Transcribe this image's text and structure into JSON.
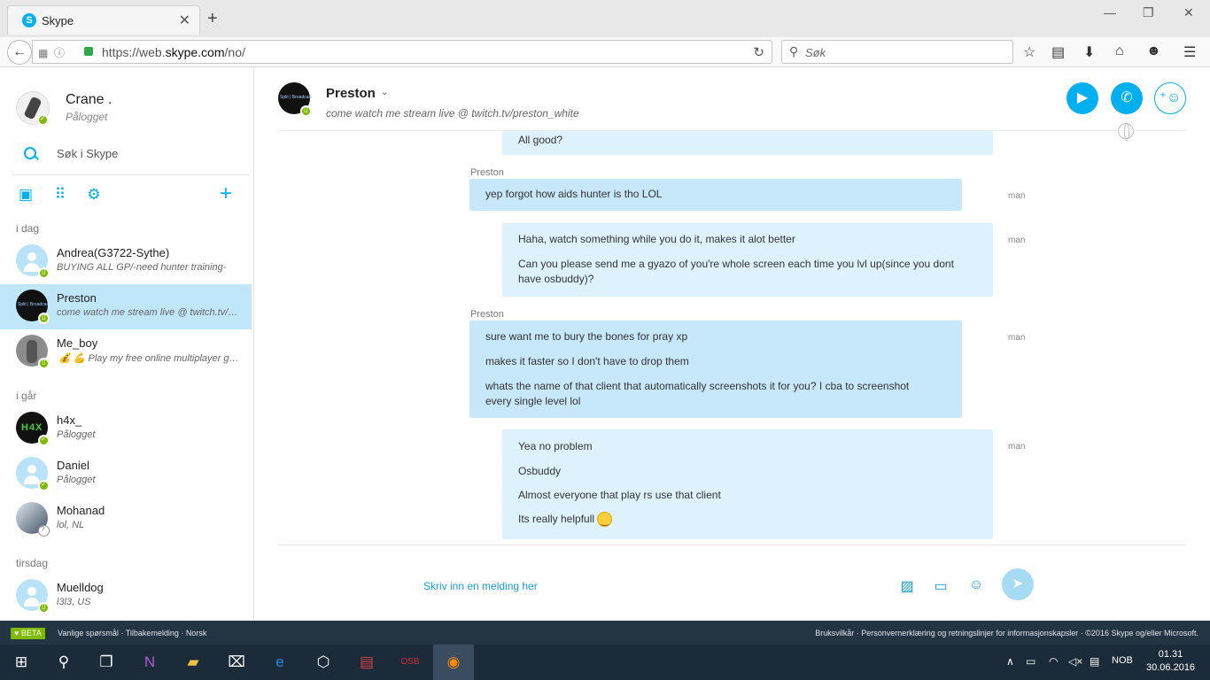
{
  "browser": {
    "tab_title": "Skype",
    "url_prefix": "https://web.",
    "url_host": "skype.com",
    "url_path": "/no/",
    "search_placeholder": "Søk"
  },
  "me": {
    "name": "Crane .",
    "status": "Pålogget"
  },
  "sidebar": {
    "search_label": "Søk i Skype",
    "groups": {
      "today": "i dag",
      "yesterday": "i går",
      "tuesday": "tirsdag"
    },
    "contacts": [
      {
        "name": "Andrea(G3722-Sythe)",
        "mood": "BUYING ALL GP/-need hunter training-"
      },
      {
        "name": "Preston",
        "mood": "come watch me stream live @ twitch.tv/preston_white"
      },
      {
        "name": "Me_boy",
        "mood": "Play my free online multiplayer game"
      },
      {
        "name": "h4x_",
        "mood": "Pålogget"
      },
      {
        "name": "Daniel",
        "mood": "Pålogget"
      },
      {
        "name": "Mohanad",
        "mood": "lol, NL"
      },
      {
        "name": "Muelldog",
        "mood": "l3l3, US"
      }
    ]
  },
  "conversation": {
    "name": "Preston",
    "mood": "come watch me stream live @ twitch.tv/preston_white",
    "messages": [
      {
        "lines": [
          "All good?"
        ]
      },
      {
        "sender": "Preston",
        "time": "man",
        "lines": [
          "yep forgot how aids hunter is tho LOL"
        ]
      },
      {
        "time": "man",
        "lines": [
          "Haha, watch something while you do it, makes it alot better",
          "Can you please send me a gyazo of you're whole screen each time you lvl up(since you dont have osbuddy)?"
        ]
      },
      {
        "sender": "Preston",
        "time": "man",
        "lines": [
          "sure want me to bury the bones for pray xp",
          "makes it faster so I don't have to drop them",
          "whats the name of that client that automatically screenshots it for you? I cba to screenshot every single level lol"
        ]
      },
      {
        "time": "man",
        "lines": [
          "Yea no problem",
          "Osbuddy",
          "Almost everyone that play rs use that client",
          "Its really helpfull"
        ]
      }
    ],
    "compose_placeholder": "Skriv inn en melding her"
  },
  "footer": {
    "beta": "BETA",
    "left": "Vanlige spørsmål  ·  Tilbakemelding  ·  Norsk",
    "right": "Bruksvilkår  ·  Personvernerklæring og retningslinjer for informasjonskapsler  ·  ©2016 Skype og/eller Microsoft."
  },
  "taskbar": {
    "lang": "NOB",
    "time": "01.31",
    "date": "30.06.2016"
  },
  "colors": {
    "accent": "#00aff0",
    "incoming": "#c7e8fa",
    "outgoing": "#ddf2fc",
    "online": "#7fba00"
  }
}
